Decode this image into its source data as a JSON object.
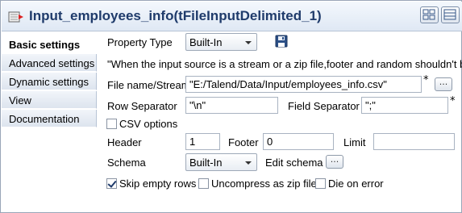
{
  "window": {
    "title": "Input_employees_info(tFileInputDelimited_1)"
  },
  "sidebar": {
    "items": [
      {
        "label": "Basic settings",
        "active": true
      },
      {
        "label": "Advanced settings",
        "active": false
      },
      {
        "label": "Dynamic settings",
        "active": false
      },
      {
        "label": "View",
        "active": false
      },
      {
        "label": "Documentation",
        "active": false
      }
    ]
  },
  "basic": {
    "property_type_label": "Property Type",
    "property_type_value": "Built-In",
    "notice": "\"When the input source is a stream or a zip file,footer and random shouldn't be big",
    "file_name_label": "File name/Stream",
    "file_name_value": "\"E:/Talend/Data/Input/employees_info.csv\"",
    "required_mark": "*",
    "browse_label": "...",
    "row_sep_label": "Row Separator",
    "row_sep_value": "\"\\n\"",
    "field_sep_label": "Field Separator",
    "field_sep_value": "\";\"",
    "csv_options_label": "CSV options",
    "csv_options_checked": false,
    "header_label": "Header",
    "header_value": "1",
    "footer_label": "Footer",
    "footer_value": "0",
    "limit_label": "Limit",
    "limit_value": "",
    "schema_label": "Schema",
    "schema_value": "Built-In",
    "edit_schema_label": "Edit schema",
    "edit_schema_button": "...",
    "skip_empty_label": "Skip empty rows",
    "skip_empty_checked": true,
    "uncompress_label": "Uncompress as zip file",
    "uncompress_checked": false,
    "die_on_error_label": "Die on error",
    "die_on_error_checked": false
  },
  "icons": {
    "component": "file-input-component-icon",
    "save": "save-floppy-icon",
    "layout_a": "view-layout-icon",
    "layout_b": "maximize-view-icon"
  }
}
